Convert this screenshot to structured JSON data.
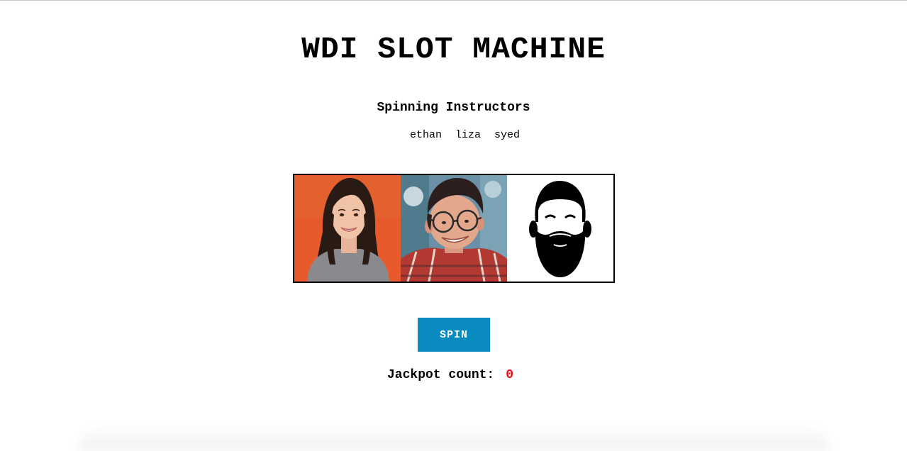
{
  "header": {
    "title": "WDI SLOT MACHINE"
  },
  "instructors": {
    "heading": "Spinning Instructors",
    "names": [
      "ethan",
      "liza",
      "syed"
    ]
  },
  "reels": [
    {
      "icon": "woman-portrait-icon",
      "background": "#e85a2c"
    },
    {
      "icon": "man-with-glasses-portrait-icon",
      "background": "#6a8fa6"
    },
    {
      "icon": "bearded-man-silhouette-icon",
      "background": "#ffffff"
    }
  ],
  "controls": {
    "spin_label": "SPIN",
    "spin_color": "#0a8bbf"
  },
  "jackpot": {
    "label": "Jackpot count:",
    "count": "0",
    "count_color": "#e0131b"
  }
}
